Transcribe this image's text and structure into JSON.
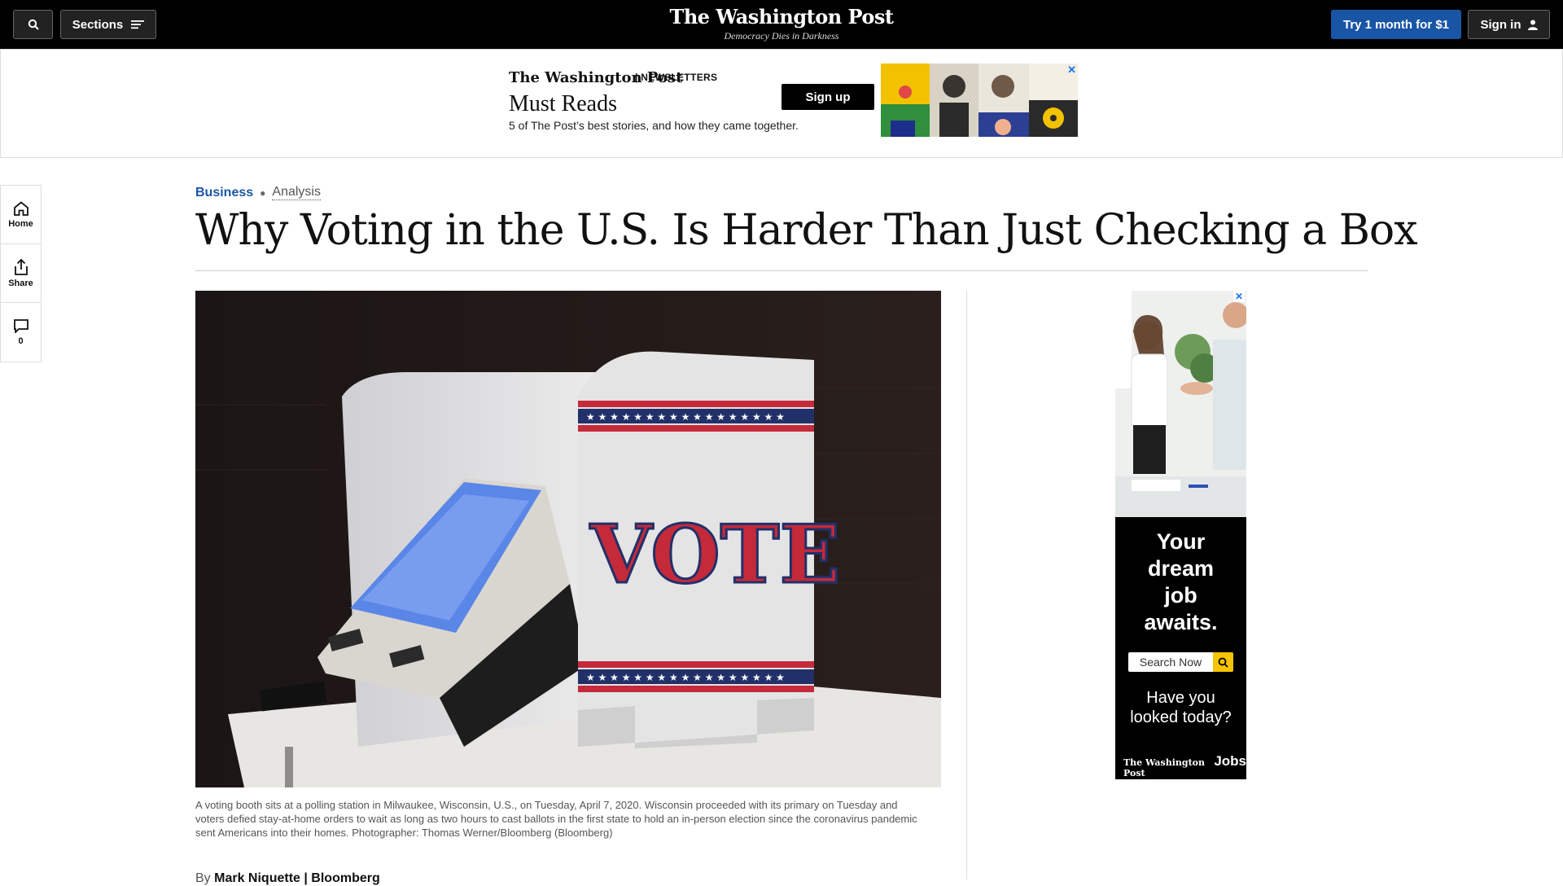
{
  "nav": {
    "sections_label": "Sections",
    "logo": "The Washington Post",
    "slogan": "Democracy Dies in Darkness",
    "try_label": "Try 1 month for $1",
    "signin_label": "Sign in"
  },
  "top_ad": {
    "logo": "The Washington Post",
    "tag": "NEWSLETTERS",
    "title": "Must Reads",
    "description": "5 of The Post’s best stories, and how they came together.",
    "signup_label": "Sign up",
    "close": "✕"
  },
  "rail": {
    "home_label": "Home",
    "share_label": "Share",
    "comments_count": "0"
  },
  "article": {
    "section": "Business",
    "label": "Analysis",
    "headline": "Why Voting in the U.S. Is Harder Than Just Checking a Box",
    "caption": "A voting booth sits at a polling station in Milwaukee, Wisconsin, U.S., on Tuesday, April 7, 2020. Wisconsin proceeded with its primary on Tuesday and voters defied stay-at-home orders to wait as long as two hours to cast ballots in the first state to hold an in-person election since the coronavirus pandemic sent Americans into their homes. Photographer: Thomas Werner/Bloomberg (Bloomberg)",
    "byline_prefix": "By",
    "byline_author": "Mark Niquette | Bloomberg",
    "booth_text": "VOTE"
  },
  "side_ad": {
    "close": "✕",
    "headline_lines": [
      "Your",
      "dream",
      "job",
      "awaits."
    ],
    "search_placeholder": "Search Now",
    "sub_lines": [
      "Have you",
      "looked today?"
    ],
    "brand_logo": "The Washington Post",
    "brand_jobs": "Jobs"
  },
  "colors": {
    "accent": "#1955a5",
    "nav_bg": "#000000",
    "ad_yellow": "#f5c400"
  }
}
